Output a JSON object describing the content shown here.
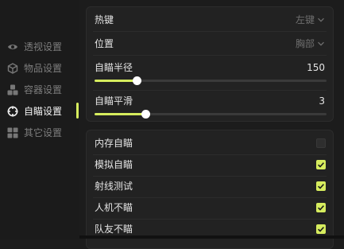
{
  "sidebar": {
    "items": [
      {
        "label": "透视设置",
        "icon": "eye-icon",
        "active": false
      },
      {
        "label": "物品设置",
        "icon": "cube-icon",
        "active": false
      },
      {
        "label": "容器设置",
        "icon": "boxes-icon",
        "active": false
      },
      {
        "label": "自瞄设置",
        "icon": "crosshair-icon",
        "active": true
      },
      {
        "label": "其它设置",
        "icon": "grid-icon",
        "active": false
      }
    ]
  },
  "aim_panel": {
    "hotkey": {
      "label": "热键",
      "value": "左键"
    },
    "position": {
      "label": "位置",
      "value": "胸部"
    },
    "radius": {
      "label": "自瞄半径",
      "value": "150",
      "fraction": 0.18
    },
    "smooth": {
      "label": "自瞄平滑",
      "value": "3",
      "fraction": 0.22
    }
  },
  "toggles": [
    {
      "label": "内存自瞄",
      "checked": false
    },
    {
      "label": "模拟自瞄",
      "checked": true
    },
    {
      "label": "射线测试",
      "checked": true
    },
    {
      "label": "人机不瞄",
      "checked": true
    },
    {
      "label": "队友不瞄",
      "checked": true
    }
  ],
  "colors": {
    "accent": "#d6ec5e",
    "background": "#1c1c1c",
    "panel": "#222222"
  }
}
